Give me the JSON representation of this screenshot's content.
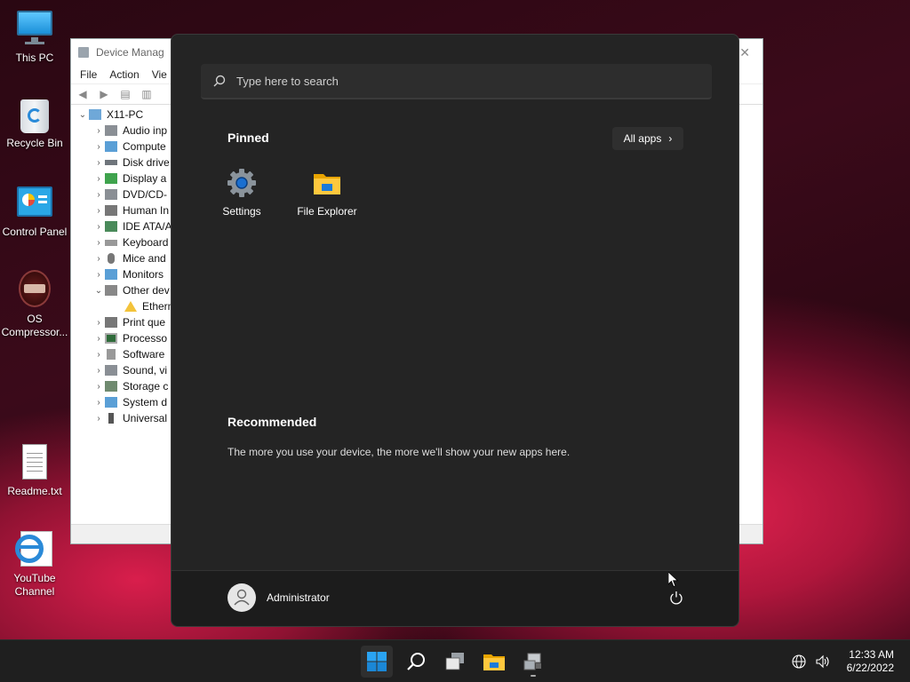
{
  "desktop": {
    "icons": [
      {
        "label": "This PC",
        "icon": "monitor-icon"
      },
      {
        "label": "Recycle Bin",
        "icon": "recycle-bin-icon"
      },
      {
        "label": "Control Panel",
        "icon": "control-panel-icon"
      },
      {
        "label": "OS Compressor...",
        "icon": "os-compressor-icon"
      },
      {
        "label": "Readme.txt",
        "icon": "text-file-icon"
      },
      {
        "label": "YouTube Channel",
        "icon": "internet-explorer-icon"
      }
    ]
  },
  "device_manager": {
    "title": "Device Manag",
    "menu": [
      "File",
      "Action",
      "Vie"
    ],
    "root": "X11-PC",
    "items": [
      {
        "label": "Audio inp",
        "icon": "audio-icon",
        "expanded": false
      },
      {
        "label": "Compute",
        "icon": "computer-icon",
        "expanded": false
      },
      {
        "label": "Disk drive",
        "icon": "disk-icon",
        "expanded": false
      },
      {
        "label": "Display a",
        "icon": "display-icon",
        "expanded": false
      },
      {
        "label": "DVD/CD-",
        "icon": "dvd-icon",
        "expanded": false
      },
      {
        "label": "Human In",
        "icon": "hid-icon",
        "expanded": false
      },
      {
        "label": "IDE ATA/A",
        "icon": "ide-icon",
        "expanded": false
      },
      {
        "label": "Keyboard",
        "icon": "keyboard-icon",
        "expanded": false
      },
      {
        "label": "Mice and",
        "icon": "mouse-icon",
        "expanded": false
      },
      {
        "label": "Monitors",
        "icon": "monitor-icon",
        "expanded": false
      },
      {
        "label": "Other dev",
        "icon": "unknown-device-icon",
        "expanded": true
      },
      {
        "label": "Ethern",
        "icon": "warning-icon",
        "child": true
      },
      {
        "label": "Print que",
        "icon": "printer-icon",
        "expanded": false
      },
      {
        "label": "Processo",
        "icon": "processor-icon",
        "expanded": false
      },
      {
        "label": "Software",
        "icon": "software-icon",
        "expanded": false
      },
      {
        "label": "Sound, vi",
        "icon": "sound-icon",
        "expanded": false
      },
      {
        "label": "Storage c",
        "icon": "storage-icon",
        "expanded": false
      },
      {
        "label": "System d",
        "icon": "system-icon",
        "expanded": false
      },
      {
        "label": "Universal",
        "icon": "usb-icon",
        "expanded": false
      }
    ]
  },
  "start_menu": {
    "search_placeholder": "Type here to search",
    "pinned_title": "Pinned",
    "all_apps_label": "All apps",
    "pinned_apps": [
      {
        "label": "Settings",
        "icon": "gear-icon"
      },
      {
        "label": "File Explorer",
        "icon": "folder-icon"
      }
    ],
    "recommended_title": "Recommended",
    "recommended_text": "The more you use your device, the more we'll show your new apps here.",
    "user_name": "Administrator"
  },
  "taskbar": {
    "items": [
      "start-icon",
      "search-icon",
      "task-view-icon",
      "file-explorer-icon",
      "device-manager-icon"
    ],
    "time": "12:33 AM",
    "date": "6/22/2022"
  },
  "colors": {
    "accent": "#0078d4",
    "start_bg": "#242424",
    "taskbar_bg": "#1f1f1f"
  }
}
